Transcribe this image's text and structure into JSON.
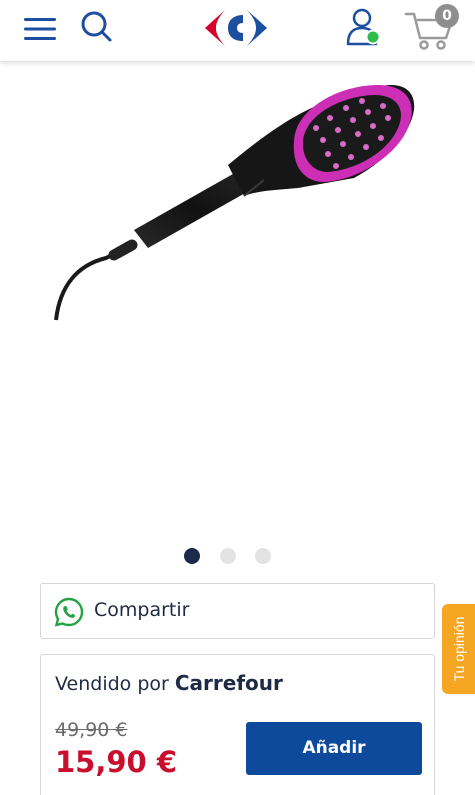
{
  "header": {
    "cart_count": "0",
    "icons": [
      "menu-icon",
      "search-icon",
      "carrefour-logo",
      "account-icon",
      "cart-icon"
    ],
    "brand_colors": {
      "blue": "#1d4fa0",
      "red": "#d6002a",
      "online_status": "#2ebc4f"
    }
  },
  "gallery": {
    "image": "hair-straightening-brush",
    "dots": 3,
    "active_index": 0
  },
  "share": {
    "icon": "whatsapp-icon",
    "label": "Compartir"
  },
  "offer": {
    "sold_by_prefix": "Vendido por",
    "seller": "Carrefour",
    "old_price": "49,90 €",
    "price": "15,90 €",
    "add_label": "Añadir"
  },
  "feedback": {
    "label": "Tu opinión"
  },
  "colors": {
    "price_red": "#c8102e",
    "button_blue": "#0e4a9c",
    "feedback_orange": "#f5a623",
    "navy": "#1b2a49"
  }
}
